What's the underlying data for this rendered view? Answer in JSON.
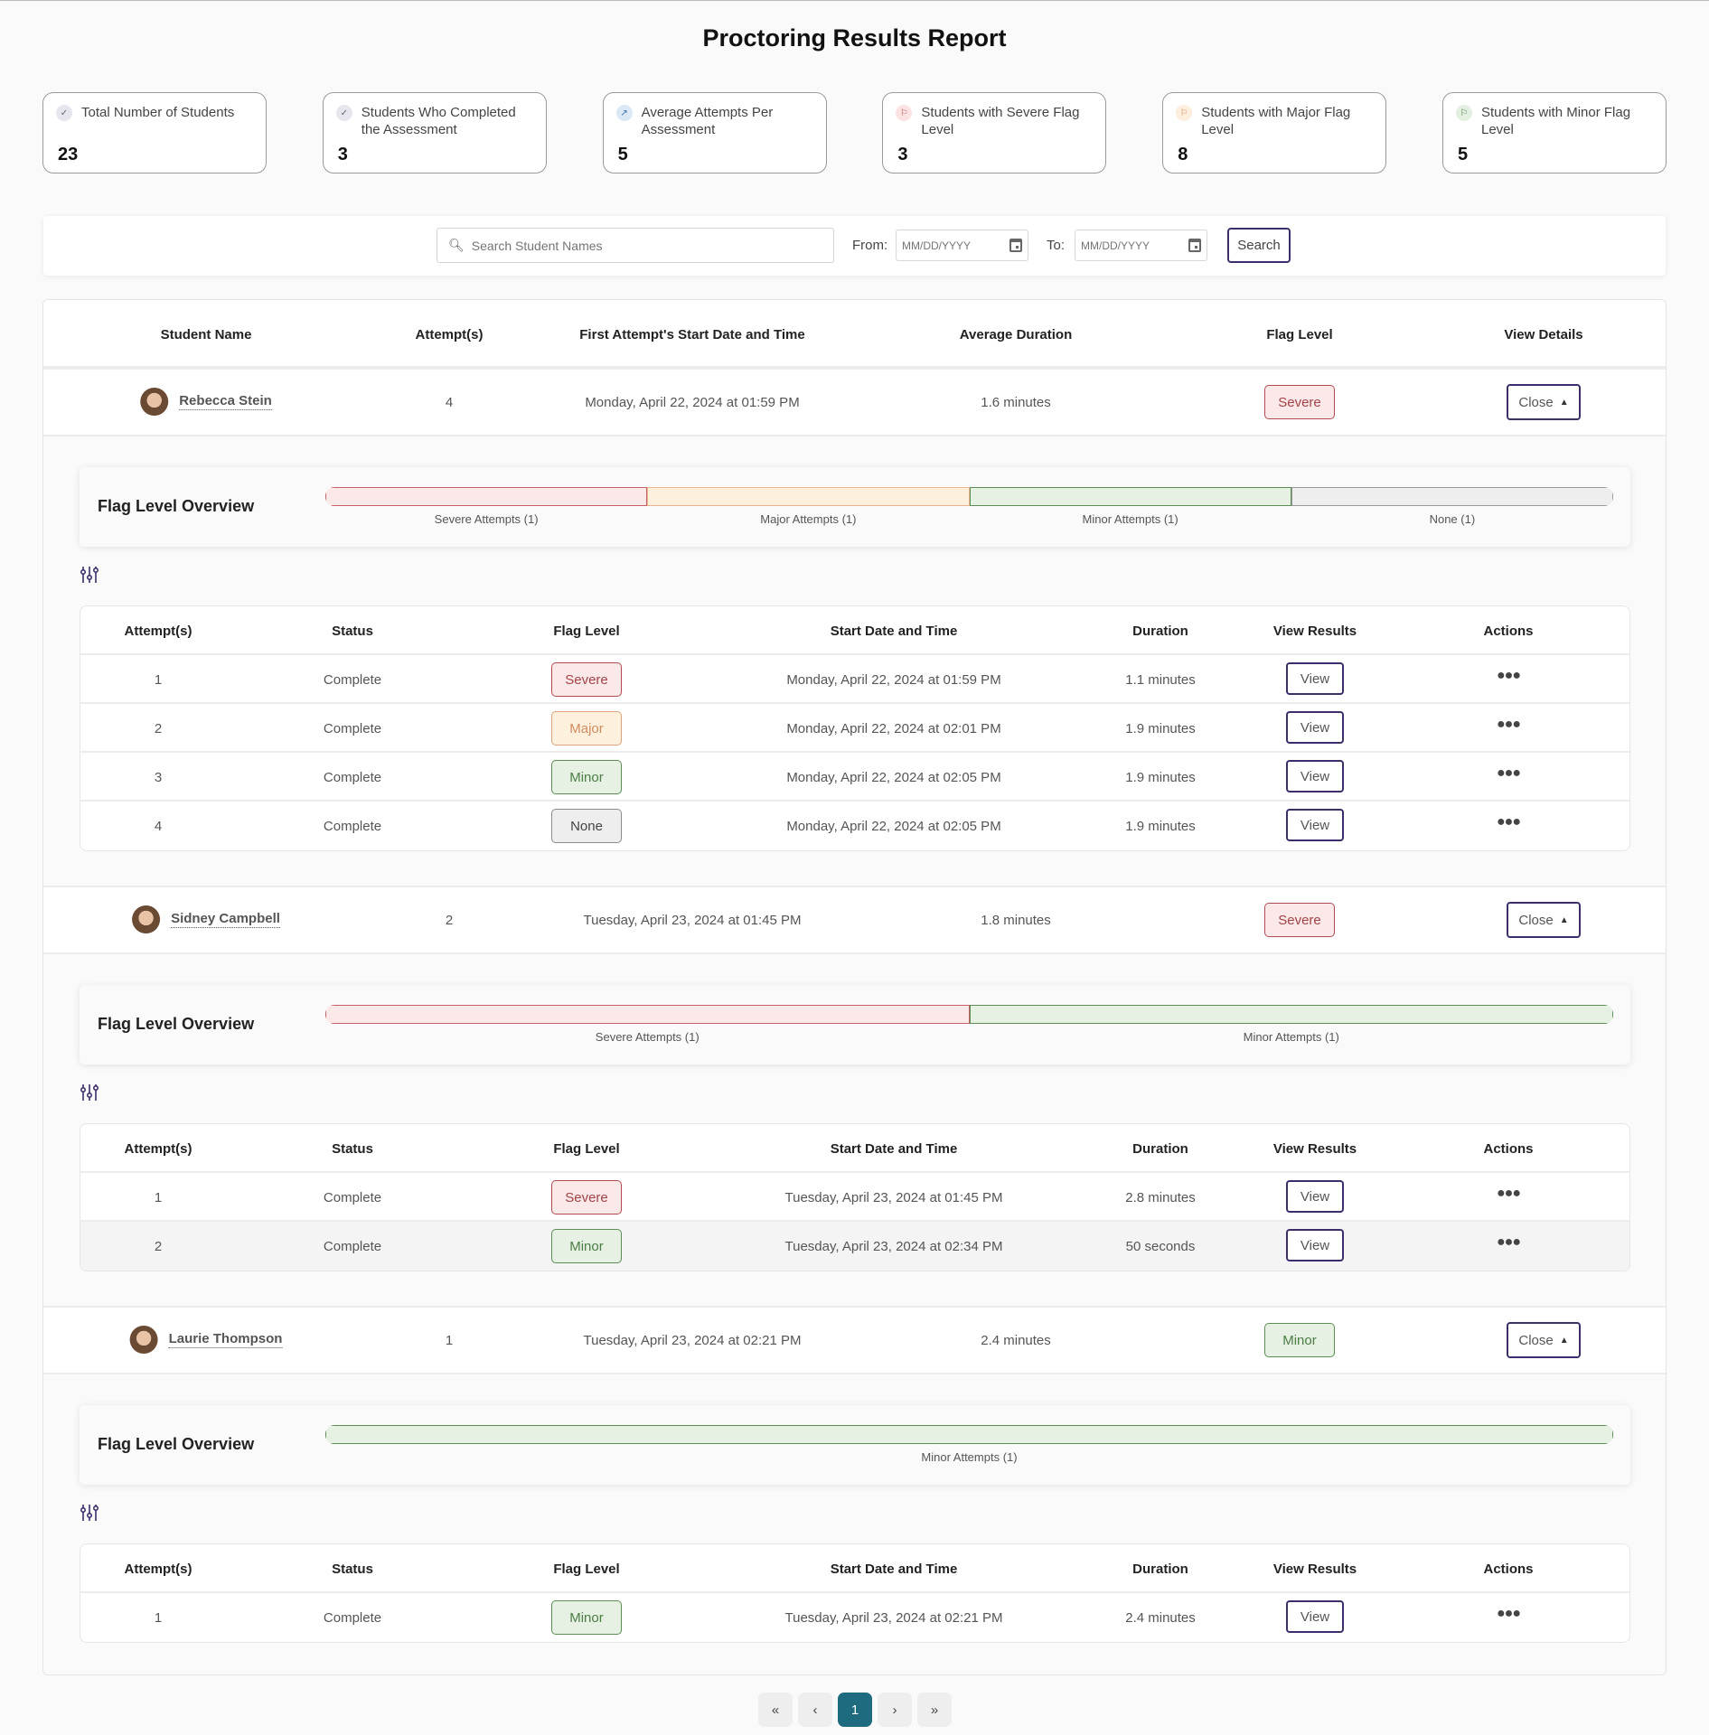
{
  "title": "Proctoring Results Report",
  "stats": [
    {
      "icon": "check-circle-icon",
      "label": "Total Number of Students",
      "value": "23",
      "icon_bg": "#e6e6ee",
      "icon_color": "#666"
    },
    {
      "icon": "check-circle-icon",
      "label": "Students Who Completed the Assessment",
      "value": "3",
      "icon_bg": "#e6e6ee",
      "icon_color": "#666"
    },
    {
      "icon": "trend-icon",
      "label": "Average Attempts Per Assessment",
      "value": "5",
      "icon_bg": "#dbe8f5",
      "icon_color": "#3b6fa8"
    },
    {
      "icon": "flag-icon",
      "label": "Students with Severe Flag Level",
      "value": "3",
      "icon_bg": "#fbe3e4",
      "icon_color": "#b24a51"
    },
    {
      "icon": "flag-icon",
      "label": "Students with Major Flag Level",
      "value": "8",
      "icon_bg": "#fdeede",
      "icon_color": "#d08b5f"
    },
    {
      "icon": "flag-icon",
      "label": "Students with Minor Flag Level",
      "value": "5",
      "icon_bg": "#e3f0e1",
      "icon_color": "#4b7d45"
    }
  ],
  "filters": {
    "search_placeholder": "Search Student Names",
    "from_label": "From:",
    "to_label": "To:",
    "date_placeholder": "MM/DD/YYYY",
    "search_button": "Search"
  },
  "main_table": {
    "headers": [
      "Student Name",
      "Attempt(s)",
      "First Attempt's Start Date and Time",
      "Average Duration",
      "Flag Level",
      "View Details"
    ]
  },
  "overview_title": "Flag Level Overview",
  "attempt_headers": [
    "Attempt(s)",
    "Status",
    "Flag Level",
    "Start Date and Time",
    "Duration",
    "View Results",
    "Actions"
  ],
  "view_label": "View",
  "close_label": "Close",
  "students": [
    {
      "name": "Rebecca Stein",
      "attempts": "4",
      "first_start": "Monday, April 22, 2024 at 01:59 PM",
      "avg_duration": "1.6 minutes",
      "flag": "Severe",
      "flag_class": "severe",
      "overview": [
        {
          "label": "Severe Attempts (1)",
          "class": "severe",
          "count": 1
        },
        {
          "label": "Major Attempts (1)",
          "class": "major",
          "count": 1
        },
        {
          "label": "Minor Attempts (1)",
          "class": "minor",
          "count": 1
        },
        {
          "label": "None (1)",
          "class": "none",
          "count": 1
        }
      ],
      "rows": [
        {
          "attempt": "1",
          "status": "Complete",
          "flag": "Severe",
          "flag_class": "severe",
          "start": "Monday, April 22, 2024 at 01:59 PM",
          "duration": "1.1 minutes"
        },
        {
          "attempt": "2",
          "status": "Complete",
          "flag": "Major",
          "flag_class": "major",
          "start": "Monday, April 22, 2024 at 02:01 PM",
          "duration": "1.9 minutes"
        },
        {
          "attempt": "3",
          "status": "Complete",
          "flag": "Minor",
          "flag_class": "minor",
          "start": "Monday, April 22, 2024 at 02:05 PM",
          "duration": "1.9 minutes"
        },
        {
          "attempt": "4",
          "status": "Complete",
          "flag": "None",
          "flag_class": "none",
          "start": "Monday, April 22, 2024 at 02:05 PM",
          "duration": "1.9 minutes"
        }
      ]
    },
    {
      "name": "Sidney Campbell",
      "attempts": "2",
      "first_start": "Tuesday, April 23, 2024 at 01:45 PM",
      "avg_duration": "1.8 minutes",
      "flag": "Severe",
      "flag_class": "severe",
      "overview": [
        {
          "label": "Severe Attempts (1)",
          "class": "severe",
          "count": 1
        },
        {
          "label": "Minor Attempts (1)",
          "class": "minor",
          "count": 1
        }
      ],
      "rows": [
        {
          "attempt": "1",
          "status": "Complete",
          "flag": "Severe",
          "flag_class": "severe",
          "start": "Tuesday, April 23, 2024 at 01:45 PM",
          "duration": "2.8 minutes"
        },
        {
          "attempt": "2",
          "status": "Complete",
          "flag": "Minor",
          "flag_class": "minor",
          "start": "Tuesday, April 23, 2024 at 02:34 PM",
          "duration": "50 seconds",
          "highlighted": true
        }
      ]
    },
    {
      "name": "Laurie Thompson",
      "attempts": "1",
      "first_start": "Tuesday, April 23, 2024 at 02:21 PM",
      "avg_duration": "2.4 minutes",
      "flag": "Minor",
      "flag_class": "minor",
      "overview": [
        {
          "label": "Minor Attempts (1)",
          "class": "minor",
          "count": 1
        }
      ],
      "rows": [
        {
          "attempt": "1",
          "status": "Complete",
          "flag": "Minor",
          "flag_class": "minor",
          "start": "Tuesday, April 23, 2024 at 02:21 PM",
          "duration": "2.4 minutes"
        }
      ]
    }
  ],
  "pagination": {
    "first": "«",
    "prev": "‹",
    "current": "1",
    "next": "›",
    "last": "»"
  }
}
